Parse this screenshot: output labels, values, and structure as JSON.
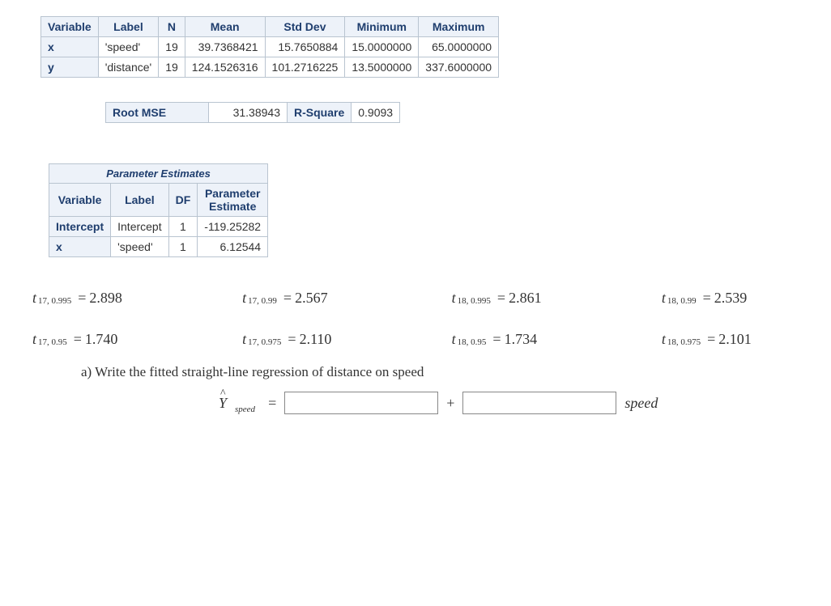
{
  "descriptive_stats": {
    "headers": [
      "Variable",
      "Label",
      "N",
      "Mean",
      "Std Dev",
      "Minimum",
      "Maximum"
    ],
    "rows": [
      {
        "var": "x",
        "label": "'speed'",
        "n": "19",
        "mean": "39.7368421",
        "std": "15.7650884",
        "min": "15.0000000",
        "max": "65.0000000"
      },
      {
        "var": "y",
        "label": "'distance'",
        "n": "19",
        "mean": "124.1526316",
        "std": "101.2716225",
        "min": "13.5000000",
        "max": "337.6000000"
      }
    ]
  },
  "model_fit": {
    "root_mse_label": "Root MSE",
    "root_mse": "31.38943",
    "rsq_label": "R-Square",
    "rsq": "0.9093"
  },
  "param_estimates": {
    "caption": "Parameter Estimates",
    "headers": [
      "Variable",
      "Label",
      "DF",
      "Parameter Estimate"
    ],
    "rows": [
      {
        "var": "Intercept",
        "label": "Intercept",
        "df": "1",
        "est": "-119.25282"
      },
      {
        "var": "x",
        "label": "'speed'",
        "df": "1",
        "est": "6.12544"
      }
    ]
  },
  "t_values": [
    {
      "sub": "17, 0.995",
      "val": "2.898"
    },
    {
      "sub": "17, 0.99",
      "val": "2.567"
    },
    {
      "sub": "18, 0.995",
      "val": "2.861"
    },
    {
      "sub": "18, 0.99",
      "val": "2.539"
    },
    {
      "sub": "17, 0.95",
      "val": "1.740"
    },
    {
      "sub": "17, 0.975",
      "val": "2.110"
    },
    {
      "sub": "18, 0.95",
      "val": "1.734"
    },
    {
      "sub": "18, 0.975",
      "val": "2.101"
    }
  ],
  "question_a": "a) Write the fitted straight-line regression of distance on speed",
  "equation": {
    "y_hat_sub": "speed",
    "plus": "+",
    "speed_label": "speed",
    "equals": "="
  }
}
